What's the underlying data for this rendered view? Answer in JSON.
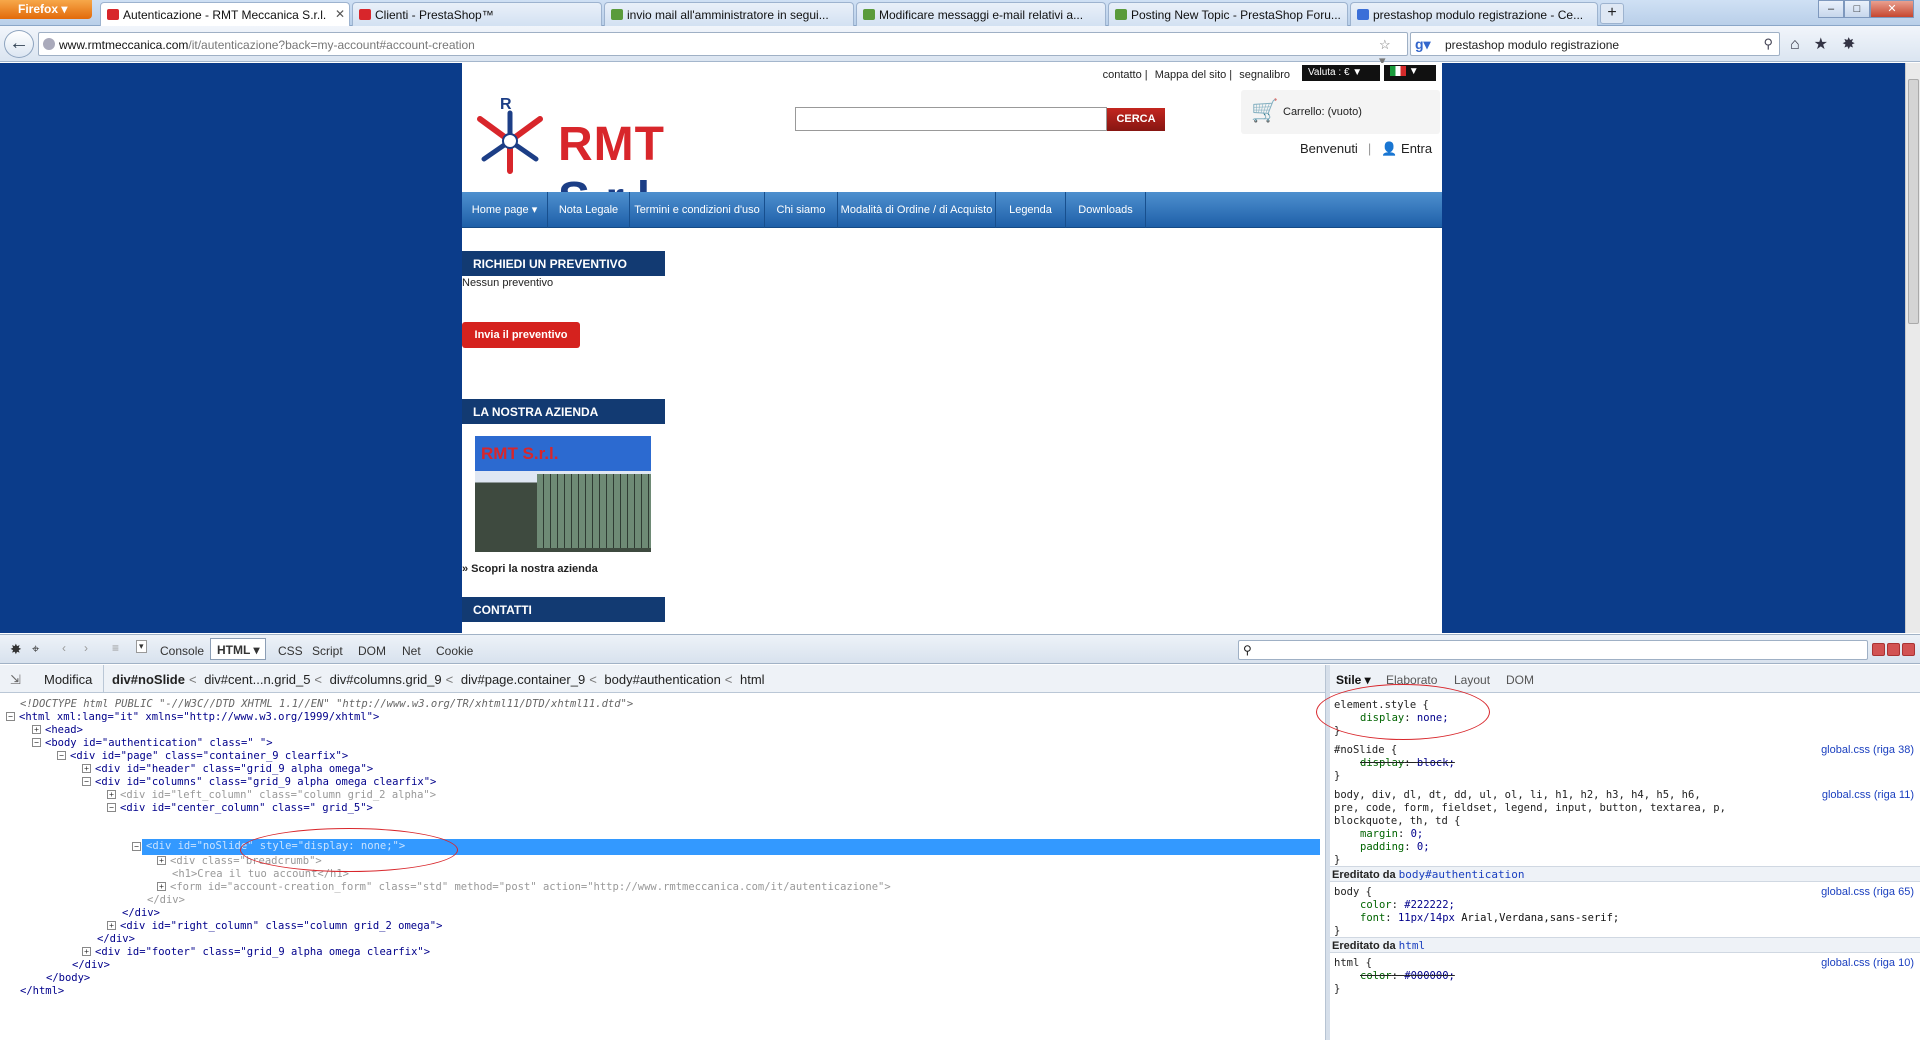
{
  "browser": {
    "menu_label": "Firefox",
    "tabs": [
      {
        "title": "Autenticazione - RMT Meccanica S.r.l.",
        "active": true
      },
      {
        "title": "Clienti - PrestaShop™",
        "active": false
      },
      {
        "title": "invio mail all'amministratore in segui...",
        "active": false
      },
      {
        "title": "Modificare messaggi e-mail relativi a...",
        "active": false
      },
      {
        "title": "Posting New Topic - PrestaShop Foru...",
        "active": false
      },
      {
        "title": "prestashop modulo registrazione - Ce...",
        "active": false
      }
    ],
    "url_domain": "www.rmtmeccanica.com",
    "url_path": "/it/autenticazione?back=my-account#account-creation",
    "search_value": "prestashop modulo registrazione"
  },
  "site": {
    "toplinks": [
      "contatto",
      "Mappa del sito",
      "segnalibro"
    ],
    "valuta": "Valuta : € ▼",
    "logo_main": "RMT",
    "logo_suffix": "S.r.l.",
    "logo_mark": "R",
    "search_button": "CERCA",
    "cart": "Carrello: (vuoto)",
    "welcome": "Benvenuti",
    "login": "Entra",
    "menu": [
      "Home page",
      "Nota Legale",
      "Termini e condizioni d'uso",
      "Chi siamo",
      "Modalità di Ordine / di Acquisto",
      "Legenda",
      "Downloads"
    ],
    "quote_head": "RICHIEDI UN PREVENTIVO",
    "quote_empty": "Nessun preventivo",
    "quote_button": "Invia il preventivo",
    "company_head": "LA NOSTRA AZIENDA",
    "company_img_text": "RMT S.r.l.",
    "company_link": "» Scopri la nostra azienda",
    "contacts_head": "CONTATTI"
  },
  "devtools": {
    "tabs": [
      "Console",
      "HTML",
      "CSS",
      "Script",
      "DOM",
      "Net",
      "Cookie"
    ],
    "edit_label": "Modifica",
    "breadcrumb": [
      "div#noSlide",
      "div#cent...n.grid_5",
      "div#columns.grid_9",
      "div#page.container_9",
      "body#authentication",
      "html"
    ],
    "side_tabs": [
      "Stile ▾",
      "Elaborato",
      "Layout",
      "DOM"
    ],
    "tree": [
      {
        "text": "<!DOCTYPE html PUBLIC \"-//W3C//DTD XHTML 1.1//EN\" \"http://www.w3.org/TR/xhtml11/DTD/xhtml11.dtd\">"
      },
      {
        "text": "<html xml:lang=\"it\" xmlns=\"http://www.w3.org/1999/xhtml\">"
      },
      {
        "text": "<head>"
      },
      {
        "text": "<body id=\"authentication\" class=\" \">"
      },
      {
        "text": "<div id=\"page\" class=\"container_9 clearfix\">"
      },
      {
        "text": "<div id=\"header\" class=\"grid_9 alpha omega\">"
      },
      {
        "text": "<div id=\"columns\" class=\"grid_9 alpha omega clearfix\">"
      },
      {
        "text": "<div id=\"left_column\" class=\"column grid_2 alpha\">"
      },
      {
        "text": "<div id=\"center_column\" class=\" grid_5\">"
      },
      {
        "text": "<div id=\"noSlide\" style=\"display: none;\">"
      },
      {
        "text": "<div class=\"breadcrumb\">"
      },
      {
        "text": "<h1>Crea il tuo account</h1>"
      },
      {
        "text": "<form id=\"account-creation_form\" class=\"std\" method=\"post\" action=\"http://www.rmtmeccanica.com/it/autenticazione\">"
      },
      {
        "text": "</div>"
      },
      {
        "text": "</div>"
      },
      {
        "text": "<div id=\"right_column\" class=\"column grid_2 omega\">"
      },
      {
        "text": "</div>"
      },
      {
        "text": "<div id=\"footer\" class=\"grid_9 alpha omega clearfix\">"
      },
      {
        "text": "</div>"
      },
      {
        "text": "</body>"
      },
      {
        "text": "</html>"
      }
    ],
    "styles": {
      "element_selector": "element.style {",
      "element_prop": "display",
      "element_val": "none;",
      "noslide_selector": "#noSlide {",
      "noslide_prop": "display",
      "noslide_val": "block;",
      "noslide_src": "global.css (riga 38)",
      "reset_selector_1": "body, div, dl, dt, dd, ul, ol, li, h1, h2, h3, h4, h5, h6,",
      "reset_selector_2": "pre, code, form, fieldset, legend, input, button, textarea, p,",
      "reset_selector_3": "blockquote, th, td {",
      "reset_src": "global.css (riga 11)",
      "margin_prop": "margin",
      "margin_val": "0;",
      "padding_prop": "padding",
      "padding_val": "0;",
      "inherited_body_label": "Ereditato da",
      "inherited_body_link": "body#authentication",
      "body_selector": "body {",
      "body_src": "global.css (riga 65)",
      "color_prop": "color",
      "color_val": "#222222;",
      "font_prop": "font",
      "font_val": "11px/14px",
      "font_family": "Arial,Verdana,sans-serif;",
      "inherited_html_label": "Ereditato da",
      "inherited_html_link": "html",
      "html_selector": "html {",
      "html_src": "global.css (riga 10)",
      "html_color_prop": "color",
      "html_color_val": "#000000;",
      "close_brace": "}"
    }
  },
  "colors": {
    "brand_red": "#d8262b",
    "brand_blue": "#1c3e86",
    "page_bg": "#0b3c8a",
    "selection": "#3399ff"
  }
}
